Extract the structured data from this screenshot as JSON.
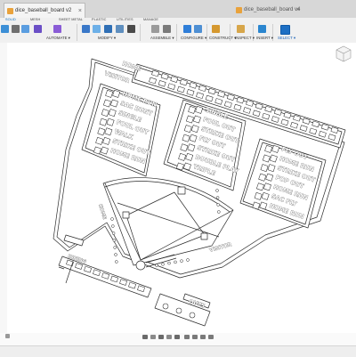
{
  "window": {
    "tabs": [
      {
        "label": "dice_baseball_board v2",
        "active": true
      },
      {
        "label": "dice_baseball_board v4",
        "active": false
      }
    ],
    "close_glyph": "×"
  },
  "ribbon": {
    "tabs": [
      "SOLID",
      "MESH",
      "SHEET METAL",
      "PLASTIC",
      "UTILITIES",
      "MANAGE"
    ],
    "active_tab": "SOLID",
    "groups": [
      {
        "label": "AUTOMATE ▾",
        "blue": false
      },
      {
        "label": "MODIFY ▾",
        "blue": false
      },
      {
        "label": "ASSEMBLE ▾",
        "blue": false
      },
      {
        "label": "CONFIGURE ▾",
        "blue": false
      },
      {
        "label": "CONSTRUCT ▾",
        "blue": false
      },
      {
        "label": "INSPECT ▾",
        "blue": false
      },
      {
        "label": "INSERT ▾",
        "blue": false
      },
      {
        "label": "SELECT ▾",
        "blue": true
      }
    ]
  },
  "board": {
    "top_panel": {
      "line1": "HOME",
      "line2": "VISITOR"
    },
    "left_card": [
      "HOME RUN",
      "SAC BUNT",
      "SINGLE",
      "FOUL OUT",
      "WALK",
      "STRIKE OUT",
      "HOME RUN"
    ],
    "mid_card": [
      "SINGLE",
      "FOUL OUT",
      "STRIKE OUT",
      "FLY OUT",
      "STRIKE OUT",
      "DOUBLE PLAY",
      "TRIPLE"
    ],
    "right_card": [
      "FLY OUT",
      "HOME RUN",
      "STRIKE OUT",
      "POP OUT",
      "HOME RUN",
      "SAC FLY",
      "HOME RUN"
    ],
    "field_label_home": "HOME",
    "field_label_visitor": "VISITOR",
    "inning_label": "INNING",
    "outs_label": "OUTS"
  },
  "colors": {
    "accent": "#0b6dbd",
    "stroke": "#2b2b2b",
    "ribbon_bg": "#f0f0f0",
    "tabbar_bg": "#d7d7d7"
  }
}
